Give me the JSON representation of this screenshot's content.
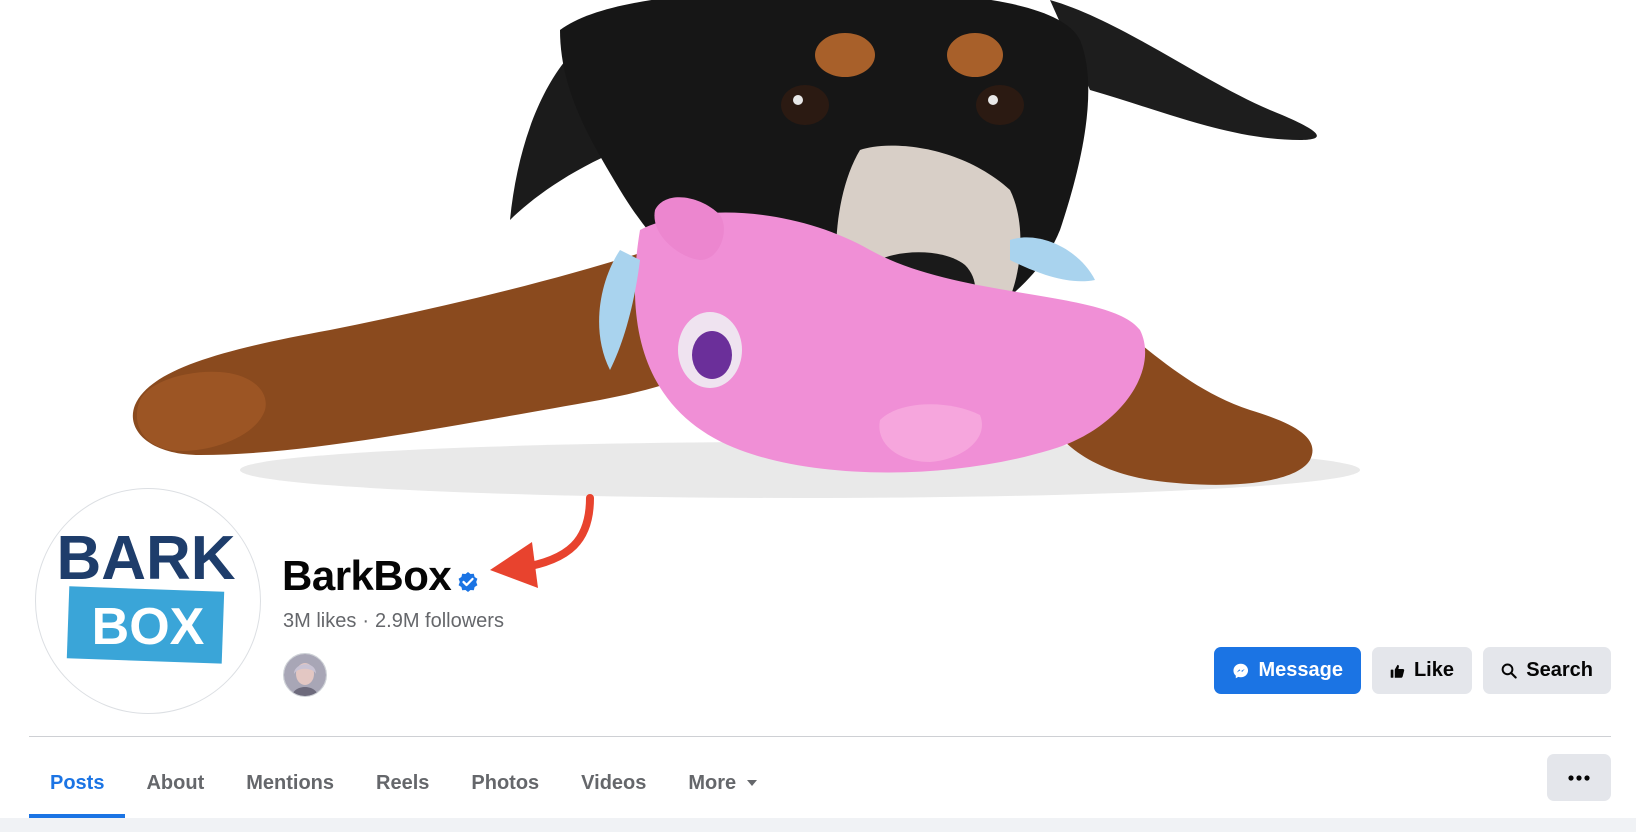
{
  "cover": {
    "description_icon": "dog-with-pink-toy-photo"
  },
  "profile": {
    "avatar_logo_top": "BARK",
    "avatar_logo_bottom": "BOX",
    "name": "BarkBox",
    "likes": "3M likes",
    "separator": "·",
    "followers": "2.9M followers"
  },
  "actions": {
    "message": "Message",
    "like": "Like",
    "search": "Search"
  },
  "tabs": [
    {
      "label": "Posts",
      "active": true
    },
    {
      "label": "About"
    },
    {
      "label": "Mentions"
    },
    {
      "label": "Reels"
    },
    {
      "label": "Photos"
    },
    {
      "label": "Videos"
    },
    {
      "label": "More"
    }
  ],
  "colors": {
    "accent": "#1b74e4",
    "annotation_arrow": "#e8432e",
    "logo_navy": "#1e3d6b",
    "logo_blue": "#3aa5d8"
  }
}
